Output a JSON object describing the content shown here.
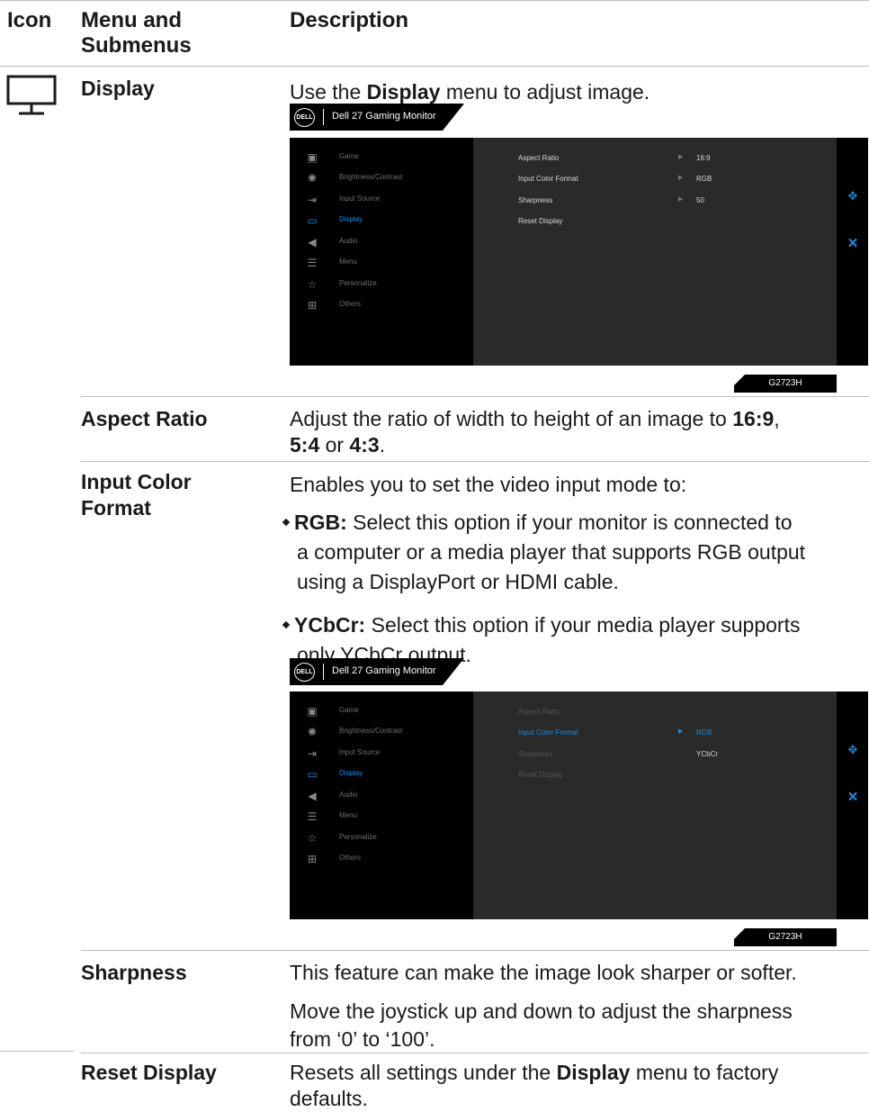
{
  "table": {
    "headers": {
      "icon": "Icon",
      "menu_line1": "Menu and",
      "menu_line2": "Submenus",
      "description": "Description"
    }
  },
  "display_row": {
    "icon": "monitor-icon",
    "name": "Display",
    "desc_pre": "Use the ",
    "desc_bold": "Display",
    "desc_post": " menu to adjust image."
  },
  "osd": {
    "brand_logo": "DELL",
    "monitor_title": "Dell 27 Gaming Monitor",
    "model": "G2723H",
    "menu_items": [
      {
        "label": "Game",
        "icon": "game-icon"
      },
      {
        "label": "Brightness/Contrast",
        "icon": "brightness-icon"
      },
      {
        "label": "Input Source",
        "icon": "input-source-icon"
      },
      {
        "label": "Display",
        "icon": "display-icon"
      },
      {
        "label": "Audio",
        "icon": "audio-icon"
      },
      {
        "label": "Menu",
        "icon": "menu-icon"
      },
      {
        "label": "Personalize",
        "icon": "star-icon"
      },
      {
        "label": "Others",
        "icon": "others-icon"
      }
    ],
    "screen1_rows": [
      {
        "label": "Aspect Ratio",
        "value": "16:9"
      },
      {
        "label": "Input Color Format",
        "value": "RGB"
      },
      {
        "label": "Sharpness",
        "value": "50"
      },
      {
        "label": "Reset Display",
        "value": ""
      }
    ],
    "screen2_rows": [
      {
        "label": "Aspect Ratio"
      },
      {
        "label": "Input Color Format",
        "value": "RGB",
        "value2": "YCbCr"
      },
      {
        "label": "Sharpness"
      },
      {
        "label": "Reset Display"
      }
    ],
    "accent_color": "#1b8be0"
  },
  "aspect_row": {
    "name": "Aspect Ratio",
    "desc_pre": "Adjust the ratio of width to height of an image to ",
    "opt1": "16:9",
    "sep1": ",",
    "opt2": "5:4",
    "sep2": " or ",
    "opt3": "4:3",
    "end": "."
  },
  "input_color_row": {
    "name_line1": "Input Color",
    "name_line2": "Format",
    "intro": "Enables you to set the video input mode to:",
    "bullet1_bold": "RGB:",
    "bullet1_line1": " Select this option if your monitor is connected to",
    "bullet1_line2": "a computer or a media player that supports RGB output",
    "bullet1_line3": "using a DisplayPort or HDMI cable.",
    "bullet2_bold": "YCbCr:",
    "bullet2_line1": " Select this option if your media player supports",
    "bullet2_line2": "only YCbCr output."
  },
  "sharpness_row": {
    "name": "Sharpness",
    "line1": "This feature can make the image look sharper or softer.",
    "line2": "Move the joystick up and down to adjust the sharpness",
    "line3": "from ‘0’ to ‘100’."
  },
  "reset_row": {
    "name": "Reset Display",
    "desc_pre": "Resets all settings under the ",
    "desc_bold": "Display",
    "desc_post": " menu to factory",
    "line2": "defaults."
  }
}
